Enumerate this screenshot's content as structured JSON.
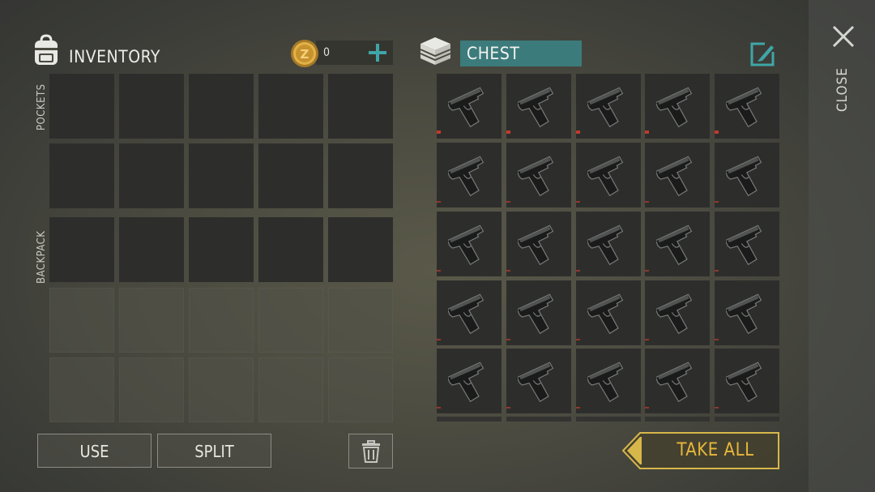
{
  "inventory": {
    "title": "INVENTORY",
    "coin_count": "0",
    "sections": {
      "pockets": "POCKETS",
      "backpack": "BACKPACK"
    }
  },
  "chest": {
    "name": "CHEST",
    "item": "pistol-icon",
    "items_visible": 25,
    "damaged_marker_rows": [
      true,
      false,
      false,
      false,
      false
    ]
  },
  "buttons": {
    "use": "USE",
    "split": "SPLIT",
    "take_all": "TAKE ALL",
    "close": "CLOSE"
  },
  "icons": [
    "backpack-icon",
    "coin-icon",
    "plus-icon",
    "chest-icon",
    "edit-icon",
    "pistol-icon",
    "trash-icon",
    "close-icon"
  ],
  "colors": {
    "accent_teal": "#3c7b7c",
    "take_all_gold": "#d7b74a",
    "damage_red": "#c03a2b"
  }
}
